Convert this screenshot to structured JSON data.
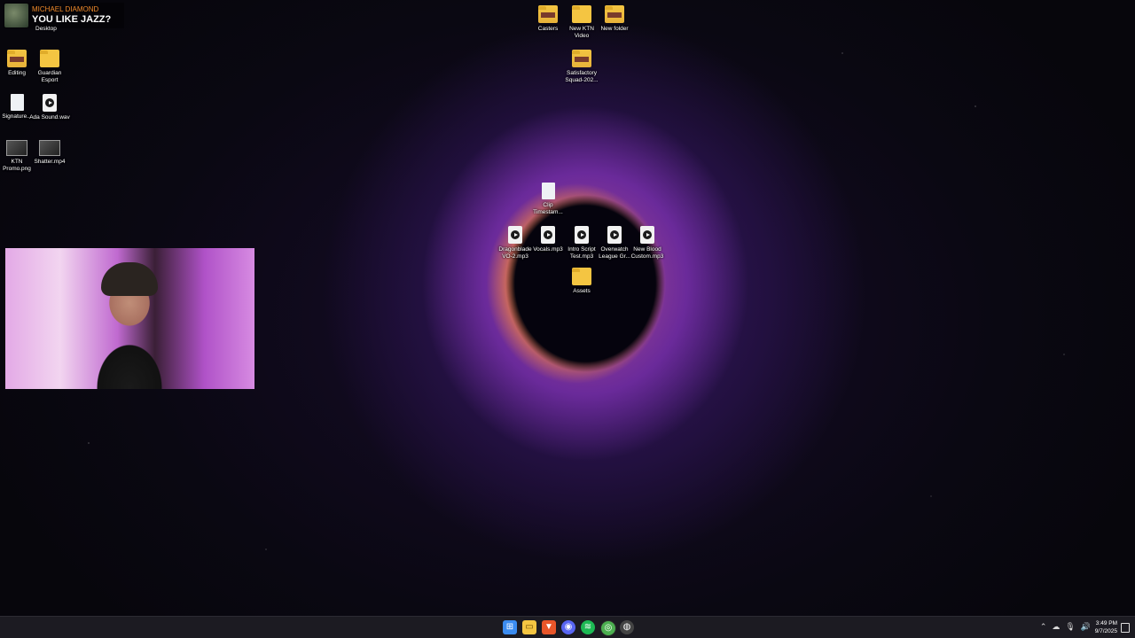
{
  "now_playing": {
    "artist": "MICHAEL DIAMOND",
    "title": "YOU LIKE JAZZ?"
  },
  "desktop_label": "Desktop",
  "left_icons": [
    {
      "label": "Editing",
      "type": "folder-img"
    },
    {
      "label": "Guardian Esport",
      "type": "folder"
    },
    {
      "label": "Signature...",
      "type": "doc"
    },
    {
      "label": "Ada Sound.wav",
      "type": "media"
    },
    {
      "label": "KTN Promo.png",
      "type": "image"
    },
    {
      "label": "Shatter.mp4",
      "type": "image"
    }
  ],
  "top_icons": [
    {
      "label": "Casters",
      "type": "folder-img"
    },
    {
      "label": "New KTN Video",
      "type": "folder"
    },
    {
      "label": "New folder",
      "type": "folder-img"
    },
    {
      "label": "Satisfactory Squad-202...",
      "type": "folder-img"
    }
  ],
  "center_icons": [
    {
      "label": "Clip Timestam...",
      "type": "doc"
    },
    {
      "label": "Dragonblade VO-2.mp3",
      "type": "media"
    },
    {
      "label": "Vocals.mp3",
      "type": "media"
    },
    {
      "label": "Intro Script Test.mp3",
      "type": "media"
    },
    {
      "label": "Overwatch League Gr...",
      "type": "media"
    },
    {
      "label": "New Blood Custom.mp3",
      "type": "media"
    },
    {
      "label": "Assets",
      "type": "folder"
    }
  ],
  "taskbar": {
    "icons": [
      "windows-start-icon",
      "file-explorer-icon",
      "brave-browser-icon",
      "discord-icon",
      "spotify-icon",
      "chrome-icon",
      "obs-icon"
    ],
    "colors": {
      "start": "#3b8cf0",
      "explorer": "#f4c542",
      "brave": "#e8562a",
      "discord": "#5865f2",
      "spotify": "#1db954",
      "chrome": "#4caf50",
      "obs": "#444444"
    }
  },
  "clock": {
    "time": "3:49 PM",
    "date": "9/7/2025"
  }
}
